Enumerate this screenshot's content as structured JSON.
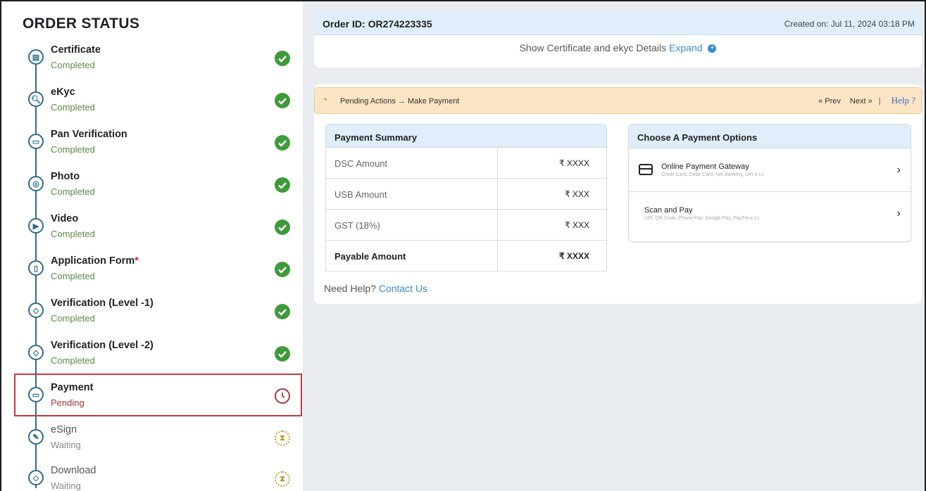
{
  "sidebar": {
    "title": "ORDER STATUS",
    "steps": [
      {
        "name": "Certificate",
        "status": "Completed",
        "icon": "certificate-icon"
      },
      {
        "name": "eKyc",
        "status": "Completed",
        "icon": "search-icon"
      },
      {
        "name": "Pan Verification",
        "status": "Completed",
        "icon": "card-icon"
      },
      {
        "name": "Photo",
        "status": "Completed",
        "icon": "photo-icon"
      },
      {
        "name": "Video",
        "status": "Completed",
        "icon": "video-icon"
      },
      {
        "name": "Application Form",
        "required_mark": "*",
        "status": "Completed",
        "icon": "document-icon"
      },
      {
        "name": "Verification (Level -1)",
        "status": "Completed",
        "icon": "shield-icon"
      },
      {
        "name": "Verification (Level -2)",
        "status": "Completed",
        "icon": "shield-icon"
      },
      {
        "name": "Payment",
        "status": "Pending",
        "icon": "card-icon"
      },
      {
        "name": "eSign",
        "status": "Waiting",
        "icon": "pen-icon"
      },
      {
        "name": "Download",
        "status": "Waiting",
        "icon": "shield-icon"
      }
    ]
  },
  "order": {
    "id_label": "Order ID: OR274223335",
    "created": "Created on: Jul 11, 2024 03:18 PM",
    "expand_text": "Show Certificate and ekyc Details",
    "expand_link": "Expand"
  },
  "actions": {
    "text": "Pending Actions → Make Payment",
    "prev": "« Prev",
    "next": "Next »",
    "help": "Help ?"
  },
  "summary": {
    "title": "Payment Summary",
    "rows": [
      {
        "label": "DSC Amount",
        "value": "₹ XXXX"
      },
      {
        "label": "USB Amount",
        "value": "₹ XXX"
      },
      {
        "label": "GST (18%)",
        "value": "₹ XXX"
      },
      {
        "label": "Payable Amount",
        "value": "₹ XXXX"
      }
    ],
    "help_text": "Need Help?",
    "help_link": "Contact Us"
  },
  "options": {
    "title": "Choose A Payment Options",
    "items": [
      {
        "title": "Online Payment Gateway",
        "subtitle": "Credit Card, Debit Card, Net Banking, UPI e.t.c"
      },
      {
        "title": "Scan and Pay",
        "subtitle": "UPI, QR Code, Phone Pay, Google Pay, PayTm e.t.c"
      }
    ]
  },
  "colors": {
    "completed": "#3f9a3a",
    "pending": "#a33a3a",
    "waiting": "#c9962b",
    "accent": "#3b8ad0"
  }
}
